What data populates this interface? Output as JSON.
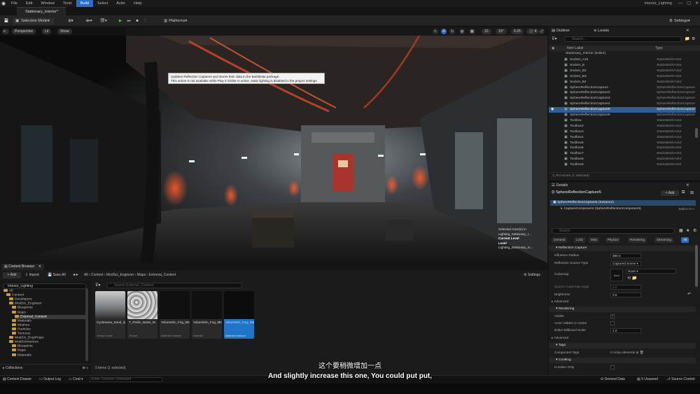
{
  "menubar": {
    "items": [
      "File",
      "Edit",
      "Window",
      "Tools",
      "Build",
      "Select",
      "Actor",
      "Help"
    ],
    "active": "Build",
    "project": "Interior_Lighting"
  },
  "tab": {
    "label": "Stationary_Interior*"
  },
  "toolbar": {
    "mode": "Selection Mode",
    "platforms": "Platforms",
    "settings": "Settings"
  },
  "viewport": {
    "perspective": "Perspective",
    "lit": "Lit",
    "show": "Show",
    "snap_angle": "10°",
    "scale": "0.25",
    "cam_speed": "4",
    "tooltip_line1": "Updates Reflection Captures and stores their data in the BuildData package.",
    "tooltip_line2": "This action is not available while Play in Editor is active, static lighting is disabled in the project settings",
    "stats": [
      "Selected Actor(s) in",
      "Lighting_Stationary_I...",
      "Current Level",
      "Level",
      "Lighting_Stationary_In..."
    ]
  },
  "outliner": {
    "tab": "Outliner",
    "tab2": "Levels",
    "search_placeholder": "Search...",
    "col_label": "Item Label",
    "col_type": "Type",
    "root": "Stationary_Interior (Editor)",
    "rows": [
      {
        "label": "Socket_A16",
        "type": "StaticMeshActor"
      },
      {
        "label": "Socket_B",
        "type": "StaticMeshActor"
      },
      {
        "label": "Socket_B2",
        "type": "StaticMeshActor"
      },
      {
        "label": "Socket_B3",
        "type": "StaticMeshActor"
      },
      {
        "label": "Socket_B4",
        "type": "StaticMeshActor"
      },
      {
        "label": "SphereReflectionCapture",
        "type": "SphereReflectionCapture"
      },
      {
        "label": "SphereReflectionCapture2",
        "type": "SphereReflectionCapture"
      },
      {
        "label": "SphereReflectionCapture3",
        "type": "SphereReflectionCapture"
      },
      {
        "label": "SphereReflectionCapture4",
        "type": "SphereReflectionCapture"
      },
      {
        "label": "SphereReflectionCapture5",
        "type": "SphereReflectionCapture"
      },
      {
        "label": "SphereReflectionCapture6",
        "type": "SphereReflectionCapture"
      },
      {
        "label": "Toolbox",
        "type": "StaticMeshActor"
      },
      {
        "label": "Toolbox2",
        "type": "StaticMeshActor"
      },
      {
        "label": "Toolbox3",
        "type": "StaticMeshActor"
      },
      {
        "label": "Toolbox4",
        "type": "StaticMeshActor"
      },
      {
        "label": "Toolbox5",
        "type": "StaticMeshActor"
      },
      {
        "label": "Toolbox6",
        "type": "StaticMeshActor"
      },
      {
        "label": "Toolbox7",
        "type": "StaticMeshActor"
      },
      {
        "label": "Toolbox8",
        "type": "StaticMeshActor"
      },
      {
        "label": "Toolbox9",
        "type": "StaticMeshActor"
      }
    ],
    "selected_index": 9,
    "footer": "1,763 actors (1 selected)"
  },
  "details": {
    "tab": "Details",
    "actor": "SphereReflectionCapture5",
    "add": "+ Add",
    "instance": "SphereReflectionCapture5 (Instance)",
    "component": "CaptureComponent (SphereReflectionComponent)",
    "edit_cpp": "Edit in C++",
    "search_placeholder": "Search",
    "filters": [
      "General",
      "LOD",
      "Misc",
      "Physics",
      "Rendering",
      "Streaming",
      "All"
    ],
    "sec_reflection": "Reflection Capture",
    "influence_radius": "Influence Radius",
    "influence_value": "580.0",
    "source_type": "Reflection Source Type",
    "source_value": "Captured Scene",
    "cubemap": "Cubemap",
    "cubemap_value": "None",
    "cubemap_thumb": "None",
    "cubemap_angle": "Source Cubemap Angle",
    "cubemap_angle_value": "0.0",
    "brightness": "Brightness",
    "brightness_value": "0.5",
    "advanced": "Advanced",
    "sec_rendering": "Rendering",
    "visible": "Visible",
    "hidden": "Actor Hidden in Game",
    "billboard": "Editor Billboard Scale",
    "billboard_value": "1.0",
    "advanced2": "Advanced",
    "sec_tags": "Tags",
    "component_tags": "Component Tags",
    "tags_value": "0 Array elements",
    "sec_cooking": "Cooking",
    "editor_only": "Is Editor Only"
  },
  "content_browser": {
    "tab": "Content Browser",
    "add": "+ Add",
    "import": "Import",
    "save_all": "Save All",
    "settings": "Settings",
    "breadcrumb": [
      "All",
      "Content",
      "ModSci_Engineer",
      "Maps",
      "External_Content"
    ],
    "tree_search": "Interior_Lighting",
    "tree": [
      "All",
      "Content",
      "Developers",
      "ModSci_Engineer",
      "Blueprints",
      "Maps",
      "External_Content",
      "Materials",
      "Meshes",
      "Particles",
      "Textures",
      "ModSci_EngiProps",
      "ModSciInteriors",
      "Blueprints",
      "Maps",
      "Materials"
    ],
    "search_placeholder": "Search External_Content",
    "assets": [
      {
        "name": "Cyclorama_Sand_light_2k",
        "type": "Texture Cube"
      },
      {
        "name": "T_Perlin_Noise_M",
        "type": "Texture"
      },
      {
        "name": "Volumetric_Fog_Mstat",
        "type": "Material Instance"
      },
      {
        "name": "Volumetric_Fog_MM",
        "type": "Material"
      },
      {
        "name": "Volumetric_Fog_Stationary_MInst",
        "type": "Material Instance"
      }
    ],
    "count": "5 items (1 selected)",
    "collections": "Collections"
  },
  "statusbar": {
    "drawer": "Content Drawer",
    "output": "Output Log",
    "cmd": "Cmd",
    "console_placeholder": "Enter Console Command",
    "derived": "Derived Data",
    "unsaved": "5 Unsaved",
    "source": "Source Control"
  },
  "subtitles": {
    "zh": "这个要稍微增加一点",
    "en": "And slightly increase this one, You could put put,"
  }
}
